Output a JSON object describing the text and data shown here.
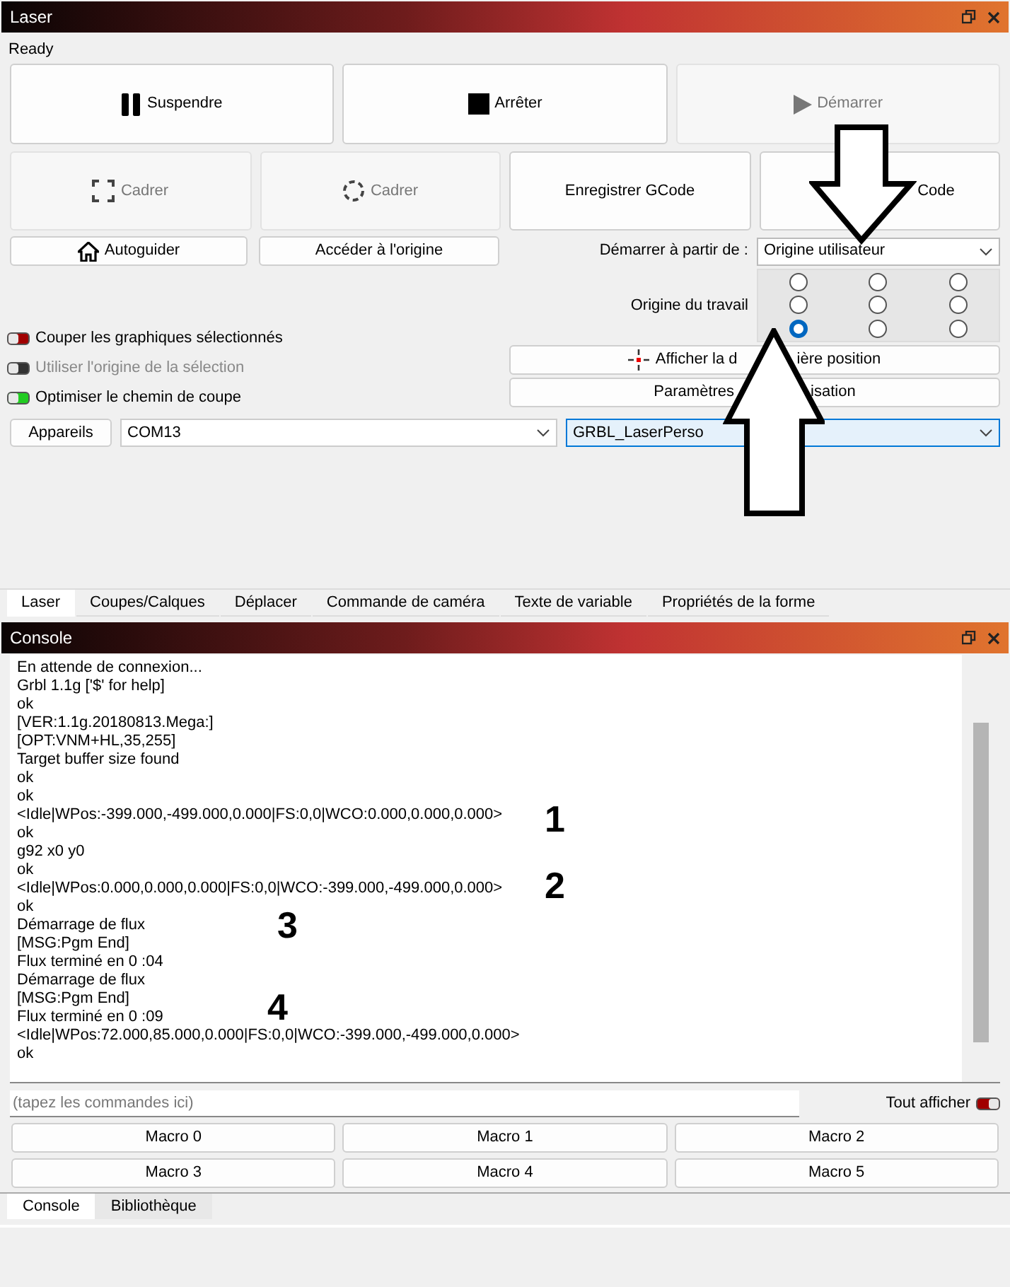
{
  "laser_panel": {
    "title": "Laser",
    "status": "Ready",
    "main_buttons": [
      {
        "kind": "pause",
        "label": "Suspendre",
        "disabled": false
      },
      {
        "kind": "stop",
        "label": "Arrêter",
        "disabled": false
      },
      {
        "kind": "play",
        "label": "Démarrer",
        "disabled": true
      }
    ],
    "frame_buttons": [
      {
        "kind": "frame-rect",
        "parts": [
          "Cadrer"
        ],
        "disabled": true
      },
      {
        "kind": "frame-circle",
        "parts": [
          "Cadrer"
        ],
        "disabled": true
      },
      {
        "kind": "plain",
        "parts": [
          "Enregistrer GCode"
        ],
        "disabled": false
      },
      {
        "kind": "plain",
        "parts": [
          "Code"
        ],
        "disabled": false
      }
    ],
    "home_buttons": [
      {
        "kind": "home",
        "label": "Autoguider"
      },
      {
        "kind": "plain",
        "label": "Accéder à l'origine"
      }
    ],
    "start_from": {
      "label": "Démarrer à partir de :",
      "value": "Origine utilisateur"
    },
    "job_origin": {
      "label": "Origine du travail",
      "radios": [
        [
          {
            "selected": false
          },
          {
            "selected": false
          },
          {
            "selected": false
          }
        ],
        [
          {
            "selected": false
          },
          {
            "selected": false
          },
          {
            "selected": false
          }
        ],
        [
          {
            "selected": true
          },
          {
            "selected": false
          },
          {
            "selected": false
          }
        ]
      ]
    },
    "toggles": [
      {
        "label": "Couper les graphiques sélectionnés",
        "color": "#a00000",
        "disabled": false
      },
      {
        "label": "Utiliser l'origine de la sélection",
        "color": "#333333",
        "disabled": true
      },
      {
        "label": "Optimiser le chemin de coupe",
        "color": "#22cc22",
        "disabled": false
      }
    ],
    "side_buttons": [
      {
        "kind": "crosshair",
        "parts": [
          "Afficher la d",
          "ière position"
        ]
      },
      {
        "kind": "plain",
        "parts": [
          "Paramètres",
          "isation"
        ]
      }
    ],
    "devices_button": "Appareils",
    "port": "COM13",
    "device": "GRBL_LaserPerso",
    "tabs": [
      {
        "label": "Laser",
        "selected": true
      },
      {
        "label": "Coupes/Calques",
        "selected": false
      },
      {
        "label": "Déplacer",
        "selected": false
      },
      {
        "label": "Commande de caméra",
        "selected": false
      },
      {
        "label": "Texte de variable",
        "selected": false
      },
      {
        "label": "Propriétés de la forme",
        "selected": false
      }
    ]
  },
  "console_panel": {
    "title": "Console",
    "lines": [
      "En attende de connexion...",
      "Grbl 1.1g ['$' for help]",
      "ok",
      "[VER:1.1g.20180813.Mega:]",
      "[OPT:VNM+HL,35,255]",
      "Target buffer size found",
      "ok",
      "ok",
      "<Idle|WPos:-399.000,-499.000,0.000|FS:0,0|WCO:0.000,0.000,0.000>",
      "ok",
      "g92 x0 y0",
      "ok",
      "<Idle|WPos:0.000,0.000,0.000|FS:0,0|WCO:-399.000,-499.000,0.000>",
      "ok",
      "Démarrage de flux",
      "[MSG:Pgm End]",
      "Flux terminé en 0 :04",
      "Démarrage de flux",
      "[MSG:Pgm End]",
      "Flux terminé en 0 :09",
      "<Idle|WPos:72.000,85.000,0.000|FS:0,0|WCO:-399.000,-499.000,0.000>",
      "ok"
    ],
    "command_placeholder": "(tapez les commandes ici)",
    "show_all": {
      "label": "Tout afficher",
      "on": true
    },
    "macros": [
      "Macro 0",
      "Macro 1",
      "Macro 2",
      "Macro 3",
      "Macro 4",
      "Macro 5"
    ],
    "tabs": [
      {
        "label": "Console",
        "selected": true
      },
      {
        "label": "Bibliothèque",
        "selected": false
      }
    ]
  },
  "annotations": {
    "numbers": [
      "1",
      "2",
      "3",
      "4"
    ]
  }
}
